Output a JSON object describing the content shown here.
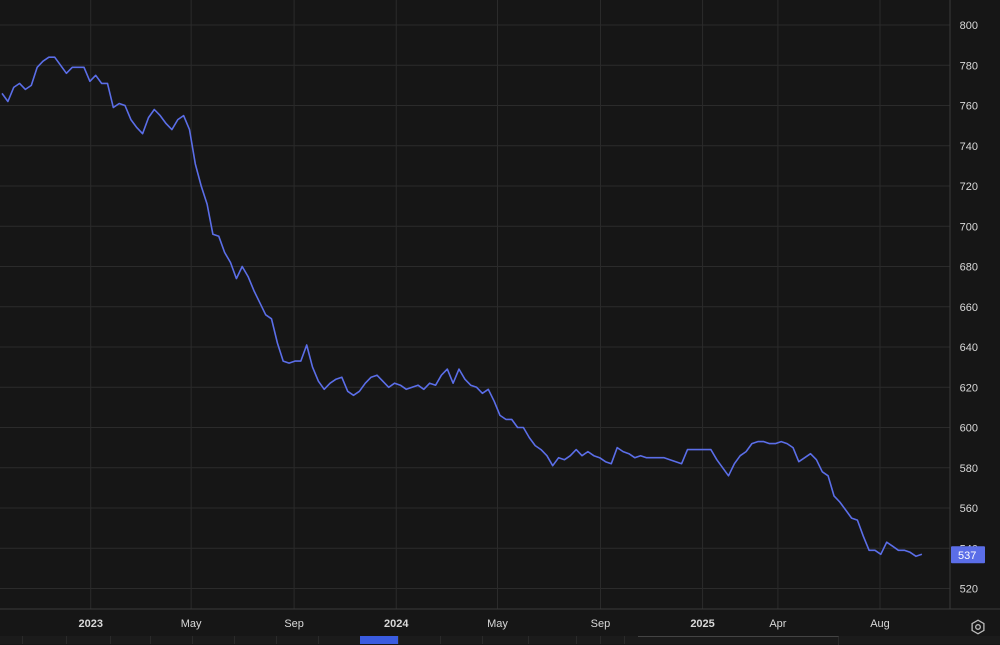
{
  "chart_data": {
    "type": "line",
    "title": "",
    "xlabel": "",
    "ylabel": "",
    "ylim": [
      510,
      805
    ],
    "grid": true,
    "x_range": [
      "2022-09-17",
      "2025-09-13"
    ],
    "y_ticks": [
      520,
      540,
      560,
      580,
      600,
      620,
      640,
      660,
      680,
      700,
      720,
      740,
      760,
      780,
      800
    ],
    "x_ticks": [
      {
        "date": "2023-01-01",
        "label": "2023",
        "bold": true
      },
      {
        "date": "2023-05-01",
        "label": "May",
        "bold": false
      },
      {
        "date": "2023-09-01",
        "label": "Sep",
        "bold": false
      },
      {
        "date": "2024-01-01",
        "label": "2024",
        "bold": true
      },
      {
        "date": "2024-05-01",
        "label": "May",
        "bold": false
      },
      {
        "date": "2024-09-01",
        "label": "Sep",
        "bold": false
      },
      {
        "date": "2025-01-01",
        "label": "2025",
        "bold": true
      },
      {
        "date": "2025-04-01",
        "label": "Apr",
        "bold": false
      },
      {
        "date": "2025-08-01",
        "label": "Aug",
        "bold": false
      }
    ],
    "series": [
      {
        "color": "#5b6ee8",
        "last_value_label": "537",
        "points": [
          [
            "2022-09-17",
            766
          ],
          [
            "2022-09-24",
            762
          ],
          [
            "2022-10-01",
            769
          ],
          [
            "2022-10-08",
            771
          ],
          [
            "2022-10-15",
            768
          ],
          [
            "2022-10-22",
            770
          ],
          [
            "2022-10-29",
            779
          ],
          [
            "2022-11-05",
            782
          ],
          [
            "2022-11-12",
            784
          ],
          [
            "2022-11-19",
            784
          ],
          [
            "2022-11-26",
            780
          ],
          [
            "2022-12-03",
            776
          ],
          [
            "2022-12-10",
            779
          ],
          [
            "2022-12-17",
            779
          ],
          [
            "2022-12-24",
            779
          ],
          [
            "2022-12-31",
            772
          ],
          [
            "2023-01-07",
            775
          ],
          [
            "2023-01-14",
            771
          ],
          [
            "2023-01-21",
            771
          ],
          [
            "2023-01-28",
            759
          ],
          [
            "2023-02-04",
            761
          ],
          [
            "2023-02-11",
            760
          ],
          [
            "2023-02-18",
            753
          ],
          [
            "2023-02-25",
            749
          ],
          [
            "2023-03-04",
            746
          ],
          [
            "2023-03-11",
            754
          ],
          [
            "2023-03-18",
            758
          ],
          [
            "2023-03-25",
            755
          ],
          [
            "2023-04-01",
            751
          ],
          [
            "2023-04-08",
            748
          ],
          [
            "2023-04-15",
            753
          ],
          [
            "2023-04-22",
            755
          ],
          [
            "2023-04-29",
            748
          ],
          [
            "2023-05-06",
            731
          ],
          [
            "2023-05-13",
            720
          ],
          [
            "2023-05-20",
            711
          ],
          [
            "2023-05-27",
            696
          ],
          [
            "2023-06-03",
            695
          ],
          [
            "2023-06-10",
            687
          ],
          [
            "2023-06-17",
            682
          ],
          [
            "2023-06-24",
            674
          ],
          [
            "2023-07-01",
            680
          ],
          [
            "2023-07-08",
            675
          ],
          [
            "2023-07-15",
            668
          ],
          [
            "2023-07-22",
            662
          ],
          [
            "2023-07-29",
            656
          ],
          [
            "2023-08-05",
            654
          ],
          [
            "2023-08-12",
            642
          ],
          [
            "2023-08-19",
            633
          ],
          [
            "2023-08-26",
            632
          ],
          [
            "2023-09-02",
            633
          ],
          [
            "2023-09-09",
            633
          ],
          [
            "2023-09-16",
            641
          ],
          [
            "2023-09-23",
            630
          ],
          [
            "2023-09-30",
            623
          ],
          [
            "2023-10-07",
            619
          ],
          [
            "2023-10-14",
            622
          ],
          [
            "2023-10-21",
            624
          ],
          [
            "2023-10-28",
            625
          ],
          [
            "2023-11-04",
            618
          ],
          [
            "2023-11-11",
            616
          ],
          [
            "2023-11-18",
            618
          ],
          [
            "2023-11-25",
            622
          ],
          [
            "2023-12-02",
            625
          ],
          [
            "2023-12-09",
            626
          ],
          [
            "2023-12-16",
            623
          ],
          [
            "2023-12-23",
            620
          ],
          [
            "2023-12-30",
            622
          ],
          [
            "2024-01-06",
            621
          ],
          [
            "2024-01-13",
            619
          ],
          [
            "2024-01-20",
            620
          ],
          [
            "2024-01-27",
            621
          ],
          [
            "2024-02-03",
            619
          ],
          [
            "2024-02-10",
            622
          ],
          [
            "2024-02-17",
            621
          ],
          [
            "2024-02-24",
            626
          ],
          [
            "2024-03-02",
            629
          ],
          [
            "2024-03-09",
            622
          ],
          [
            "2024-03-16",
            629
          ],
          [
            "2024-03-23",
            624
          ],
          [
            "2024-03-30",
            621
          ],
          [
            "2024-04-06",
            620
          ],
          [
            "2024-04-13",
            617
          ],
          [
            "2024-04-20",
            619
          ],
          [
            "2024-04-27",
            613
          ],
          [
            "2024-05-04",
            606
          ],
          [
            "2024-05-11",
            604
          ],
          [
            "2024-05-18",
            604
          ],
          [
            "2024-05-25",
            600
          ],
          [
            "2024-06-01",
            600
          ],
          [
            "2024-06-08",
            595
          ],
          [
            "2024-06-15",
            591
          ],
          [
            "2024-06-22",
            589
          ],
          [
            "2024-06-29",
            586
          ],
          [
            "2024-07-06",
            581
          ],
          [
            "2024-07-13",
            585
          ],
          [
            "2024-07-20",
            584
          ],
          [
            "2024-07-27",
            586
          ],
          [
            "2024-08-03",
            589
          ],
          [
            "2024-08-10",
            586
          ],
          [
            "2024-08-17",
            588
          ],
          [
            "2024-08-24",
            586
          ],
          [
            "2024-08-31",
            585
          ],
          [
            "2024-09-07",
            583
          ],
          [
            "2024-09-14",
            582
          ],
          [
            "2024-09-21",
            590
          ],
          [
            "2024-09-28",
            588
          ],
          [
            "2024-10-05",
            587
          ],
          [
            "2024-10-12",
            585
          ],
          [
            "2024-10-19",
            586
          ],
          [
            "2024-10-26",
            585
          ],
          [
            "2024-11-02",
            585
          ],
          [
            "2024-11-09",
            585
          ],
          [
            "2024-11-16",
            585
          ],
          [
            "2024-11-23",
            584
          ],
          [
            "2024-11-30",
            583
          ],
          [
            "2024-12-07",
            582
          ],
          [
            "2024-12-14",
            589
          ],
          [
            "2024-12-21",
            589
          ],
          [
            "2024-12-28",
            589
          ],
          [
            "2025-01-04",
            589
          ],
          [
            "2025-01-11",
            589
          ],
          [
            "2025-01-18",
            584
          ],
          [
            "2025-01-25",
            580
          ],
          [
            "2025-02-01",
            576
          ],
          [
            "2025-02-08",
            582
          ],
          [
            "2025-02-15",
            586
          ],
          [
            "2025-02-22",
            588
          ],
          [
            "2025-03-01",
            592
          ],
          [
            "2025-03-08",
            593
          ],
          [
            "2025-03-15",
            593
          ],
          [
            "2025-03-22",
            592
          ],
          [
            "2025-03-29",
            592
          ],
          [
            "2025-04-05",
            593
          ],
          [
            "2025-04-12",
            592
          ],
          [
            "2025-04-19",
            590
          ],
          [
            "2025-04-26",
            583
          ],
          [
            "2025-05-03",
            585
          ],
          [
            "2025-05-10",
            587
          ],
          [
            "2025-05-17",
            584
          ],
          [
            "2025-05-24",
            578
          ],
          [
            "2025-05-31",
            576
          ],
          [
            "2025-06-07",
            566
          ],
          [
            "2025-06-14",
            563
          ],
          [
            "2025-06-21",
            559
          ],
          [
            "2025-06-28",
            555
          ],
          [
            "2025-07-05",
            554
          ],
          [
            "2025-07-12",
            546
          ],
          [
            "2025-07-19",
            539
          ],
          [
            "2025-07-26",
            539
          ],
          [
            "2025-08-02",
            537
          ],
          [
            "2025-08-09",
            543
          ],
          [
            "2025-08-16",
            541
          ],
          [
            "2025-08-23",
            539
          ],
          [
            "2025-08-30",
            539
          ],
          [
            "2025-09-06",
            538
          ],
          [
            "2025-09-13",
            536
          ],
          [
            "2025-09-20",
            537
          ]
        ]
      }
    ]
  },
  "colors": {
    "background": "#161616",
    "grid": "#2b2b2b",
    "axis_text": "#d9d9d9",
    "line": "#5b6ee8",
    "badge_bg": "#5b6ee8",
    "badge_text": "#ffffff"
  },
  "icons": {
    "settings": "gear-icon"
  }
}
